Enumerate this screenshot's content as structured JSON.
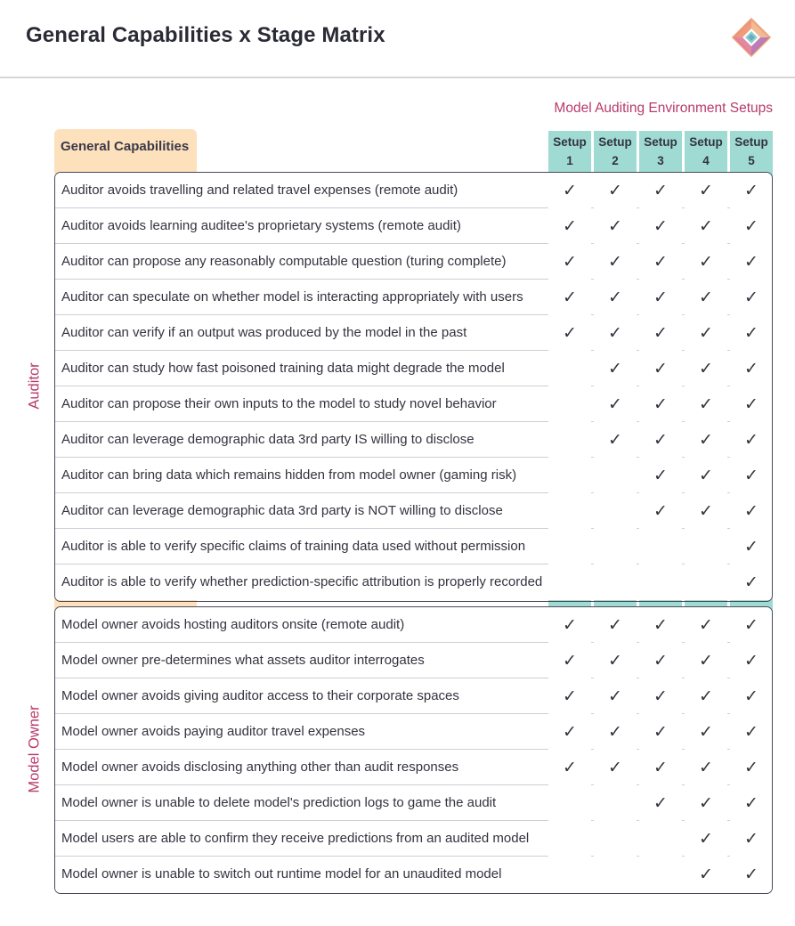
{
  "title": "General Capabilities x Stage Matrix",
  "logo_icon": "diamond-logo-icon",
  "setups_heading": "Model Auditing Environment Setups",
  "capabilities_header": "General Capabilities",
  "setups": [
    {
      "line1": "Setup",
      "line2": "1"
    },
    {
      "line1": "Setup",
      "line2": "2"
    },
    {
      "line1": "Setup",
      "line2": "3"
    },
    {
      "line1": "Setup",
      "line2": "4"
    },
    {
      "line1": "Setup",
      "line2": "5"
    }
  ],
  "check_glyph": "✓",
  "colors": {
    "accent": "#b83b6a",
    "setup_teal": "#9fdbd2",
    "capabilities_tan": "#fde0bc"
  },
  "groups": [
    {
      "label": "Auditor",
      "rows": [
        {
          "label": "Auditor avoids travelling and related travel expenses (remote audit)",
          "checks": [
            true,
            true,
            true,
            true,
            true
          ]
        },
        {
          "label": "Auditor avoids learning auditee's proprietary systems (remote audit)",
          "checks": [
            true,
            true,
            true,
            true,
            true
          ]
        },
        {
          "label": "Auditor can propose any reasonably computable question (turing complete)",
          "checks": [
            true,
            true,
            true,
            true,
            true
          ]
        },
        {
          "label": "Auditor can speculate on whether model is interacting appropriately with users",
          "checks": [
            true,
            true,
            true,
            true,
            true
          ]
        },
        {
          "label": "Auditor can verify if an output was produced by the model in the past",
          "checks": [
            true,
            true,
            true,
            true,
            true
          ]
        },
        {
          "label": "Auditor can study how fast poisoned training data might degrade the model",
          "checks": [
            false,
            true,
            true,
            true,
            true
          ]
        },
        {
          "label": "Auditor can propose their own inputs to the model to study novel behavior",
          "checks": [
            false,
            true,
            true,
            true,
            true
          ]
        },
        {
          "label": "Auditor can leverage demographic data 3rd party IS willing to disclose",
          "checks": [
            false,
            true,
            true,
            true,
            true
          ]
        },
        {
          "label": "Auditor can bring data which remains hidden from model owner (gaming risk)",
          "checks": [
            false,
            false,
            true,
            true,
            true
          ]
        },
        {
          "label": "Auditor can leverage demographic data 3rd party is NOT willing to disclose",
          "checks": [
            false,
            false,
            true,
            true,
            true
          ]
        },
        {
          "label": "Auditor is able to verify specific claims of training data used without permission",
          "checks": [
            false,
            false,
            false,
            false,
            true
          ]
        },
        {
          "label": "Auditor is able to verify whether prediction-specific attribution is properly recorded",
          "checks": [
            false,
            false,
            false,
            false,
            true
          ]
        }
      ]
    },
    {
      "label": "Model Owner",
      "rows": [
        {
          "label": "Model owner avoids hosting auditors onsite (remote audit)",
          "checks": [
            true,
            true,
            true,
            true,
            true
          ]
        },
        {
          "label": "Model owner pre-determines what assets auditor interrogates",
          "checks": [
            true,
            true,
            true,
            true,
            true
          ]
        },
        {
          "label": "Model owner avoids giving auditor access to their corporate spaces",
          "checks": [
            true,
            true,
            true,
            true,
            true
          ]
        },
        {
          "label": "Model owner avoids paying auditor travel expenses",
          "checks": [
            true,
            true,
            true,
            true,
            true
          ]
        },
        {
          "label": "Model owner avoids disclosing anything other than audit responses",
          "checks": [
            true,
            true,
            true,
            true,
            true
          ]
        },
        {
          "label": "Model owner is unable to delete model's prediction logs to game the audit",
          "checks": [
            false,
            false,
            true,
            true,
            true
          ]
        },
        {
          "label": "Model users are able to confirm they receive predictions from an audited model",
          "checks": [
            false,
            false,
            false,
            true,
            true
          ]
        },
        {
          "label": "Model owner is unable to switch out runtime model for an unaudited model",
          "checks": [
            false,
            false,
            false,
            true,
            true
          ]
        }
      ]
    }
  ]
}
